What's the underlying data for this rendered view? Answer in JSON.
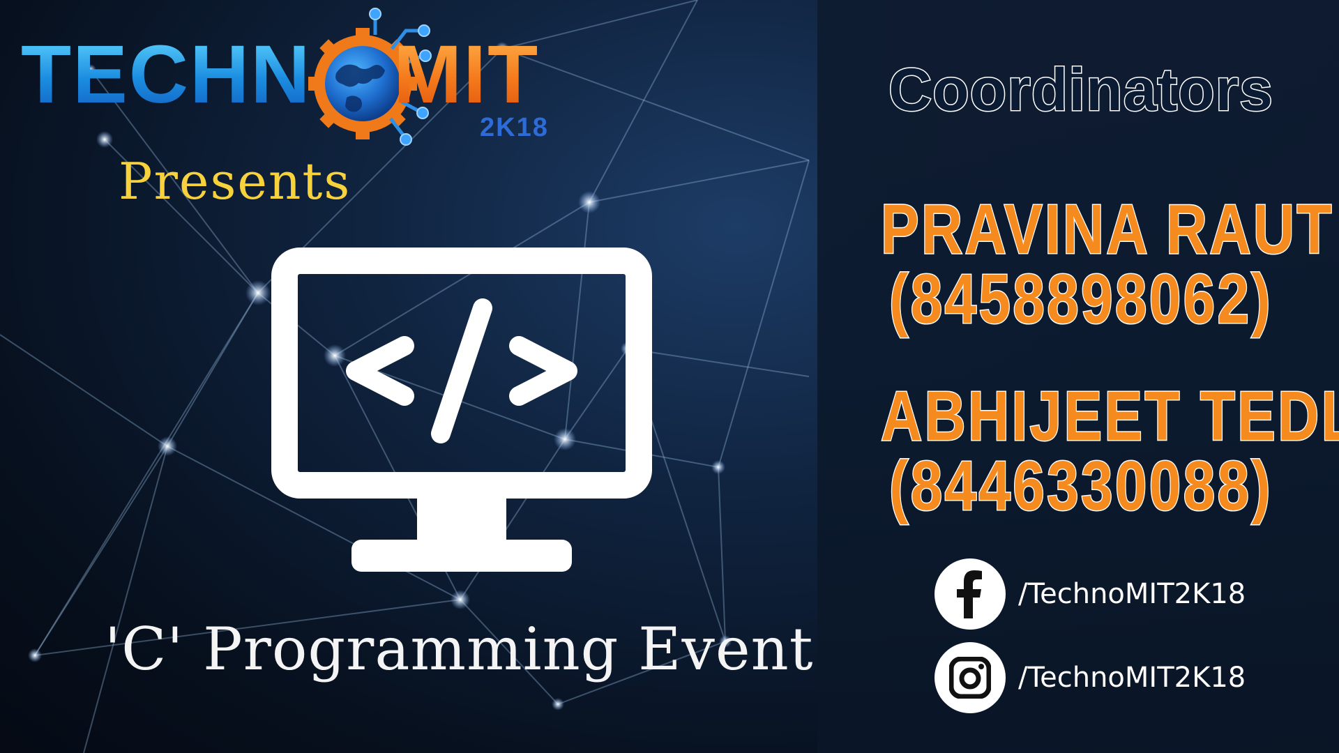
{
  "logo": {
    "text_left": "TECHN",
    "text_right": "MIT",
    "year": "2K18"
  },
  "presents": "Presents",
  "event": {
    "title": "'C' Programming Event",
    "icon": "code-monitor-icon"
  },
  "coordinators": {
    "heading": "Coordinators",
    "people": [
      {
        "name": "PRAVINA RAUT",
        "phone": "(8458898062)"
      },
      {
        "name": "ABHIJEET TEDLE",
        "phone": "(8446330088)"
      }
    ]
  },
  "social": [
    {
      "platform": "facebook",
      "icon": "facebook-icon",
      "handle": "/TechnoMIT2K18"
    },
    {
      "platform": "instagram",
      "icon": "instagram-icon",
      "handle": "/TechnoMIT2K18"
    }
  ],
  "colors": {
    "accent_orange": "#f58a1f",
    "presents_yellow": "#f7d23c",
    "logo_blue": "#1b8de0",
    "background": "#0a1424"
  }
}
